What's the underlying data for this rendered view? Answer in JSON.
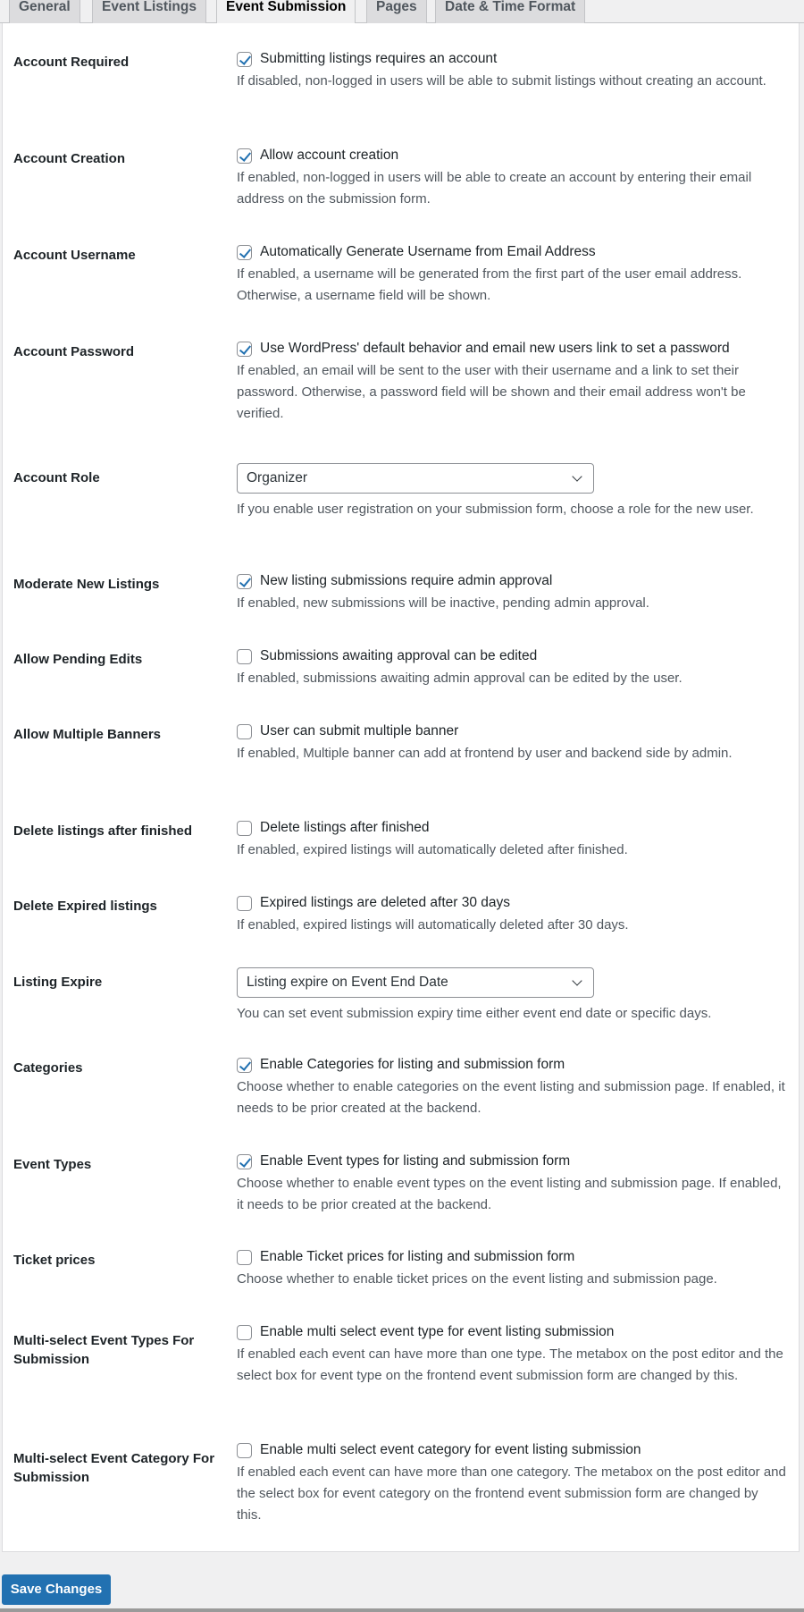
{
  "tabs": [
    {
      "label": "General",
      "active": false
    },
    {
      "label": "Event Listings",
      "active": false
    },
    {
      "label": "Event Submission",
      "active": true
    },
    {
      "label": "Pages",
      "active": false
    },
    {
      "label": "Date & Time Format",
      "active": false
    }
  ],
  "settings": [
    {
      "label": "Account Required",
      "type": "checkbox",
      "checked": true,
      "option": "Submitting listings requires an account",
      "description": "If disabled, non-logged in users will be able to submit listings without creating an account."
    },
    {
      "label": "Account Creation",
      "type": "checkbox",
      "checked": true,
      "option": "Allow account creation",
      "description": "If enabled, non-logged in users will be able to create an account by entering their email address on the submission form."
    },
    {
      "label": "Account Username",
      "type": "checkbox",
      "checked": true,
      "option": "Automatically Generate Username from Email Address",
      "description": "If enabled, a username will be generated from the first part of the user email address. Otherwise, a username field will be shown."
    },
    {
      "label": "Account Password",
      "type": "checkbox",
      "checked": true,
      "option": "Use WordPress' default behavior and email new users link to set a password",
      "description": "If enabled, an email will be sent to the user with their username and a link to set their password. Otherwise, a password field will be shown and their email address won't be verified."
    },
    {
      "label": "Account Role",
      "type": "select",
      "value": "Organizer",
      "description": "If you enable user registration on your submission form, choose a role for the new user."
    },
    {
      "label": "Moderate New Listings",
      "type": "checkbox",
      "checked": true,
      "option": "New listing submissions require admin approval",
      "description": "If enabled, new submissions will be inactive, pending admin approval."
    },
    {
      "label": "Allow Pending Edits",
      "type": "checkbox",
      "checked": false,
      "option": "Submissions awaiting approval can be edited",
      "description": "If enabled, submissions awaiting admin approval can be edited by the user."
    },
    {
      "label": "Allow Multiple Banners",
      "type": "checkbox",
      "checked": false,
      "option": "User can submit multiple banner",
      "description": "If enabled, Multiple banner can add at frontend by user and backend side by admin."
    },
    {
      "label": "Delete listings after finished",
      "type": "checkbox",
      "checked": false,
      "option": "Delete listings after finished",
      "description": "If enabled, expired listings will automatically deleted after finished."
    },
    {
      "label": "Delete Expired listings",
      "type": "checkbox",
      "checked": false,
      "option": "Expired listings are deleted after 30 days",
      "description": "If enabled, expired listings will automatically deleted after 30 days."
    },
    {
      "label": "Listing Expire",
      "type": "select",
      "value": "Listing expire on Event End Date",
      "description": "You can set event submission expiry time either event end date or specific days."
    },
    {
      "label": "Categories",
      "type": "checkbox",
      "checked": true,
      "option": "Enable Categories for listing and submission form",
      "description": "Choose whether to enable categories on the event listing and submission page. If enabled, it needs to be prior created at the backend."
    },
    {
      "label": "Event Types",
      "type": "checkbox",
      "checked": true,
      "option": "Enable Event types for listing and submission form",
      "description": "Choose whether to enable event types on the event listing and submission page. If enabled, it needs to be prior created at the backend."
    },
    {
      "label": "Ticket prices",
      "type": "checkbox",
      "checked": false,
      "option": "Enable Ticket prices for listing and submission form",
      "description": "Choose whether to enable ticket prices on the event listing and submission page."
    },
    {
      "label": "Multi-select Event Types For Submission",
      "type": "checkbox",
      "checked": false,
      "option": "Enable multi select event type for event listing submission",
      "description": "If enabled each event can have more than one type. The metabox on the post editor and the select box for event type on the frontend event submission form are changed by this."
    },
    {
      "label": "Multi-select Event Category For Submission",
      "type": "checkbox",
      "checked": false,
      "option": "Enable multi select event category for event listing submission",
      "description": "If enabled each event can have more than one category. The metabox on the post editor and the select box for event category on the frontend event submission form are changed by this."
    }
  ],
  "footer": {
    "save_label": "Save Changes"
  },
  "colors": {
    "accent": "#2271b1",
    "background": "#f0f0f1",
    "panel": "#ffffff"
  }
}
